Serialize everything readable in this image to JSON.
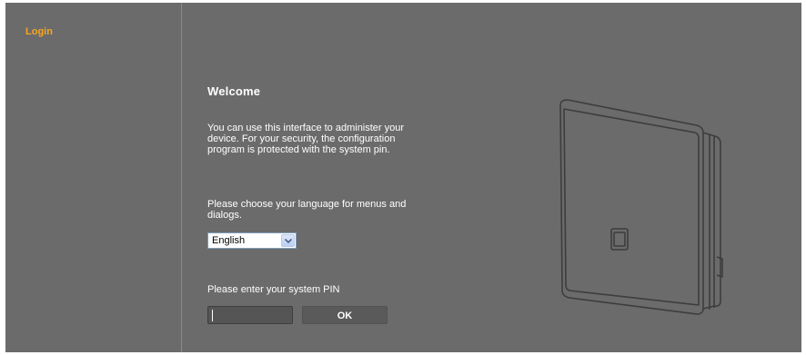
{
  "sidebar": {
    "items": [
      {
        "label": "Login",
        "active": true
      }
    ]
  },
  "main": {
    "title": "Welcome",
    "intro": "You can use this interface to administer your device. For your security, the configuration program is protected with the system pin.",
    "language_prompt": "Please choose your language for menus and dialogs.",
    "language_select": {
      "selected": "English"
    },
    "pin_prompt": "Please enter your system PIN",
    "pin_input": {
      "value": ""
    },
    "ok_label": "OK"
  },
  "colors": {
    "background": "#6b6b6b",
    "accent": "#f5a623",
    "text": "#ffffff",
    "input_background": "#555555"
  },
  "icons": [
    "chevron-down-icon",
    "device-illustration"
  ]
}
